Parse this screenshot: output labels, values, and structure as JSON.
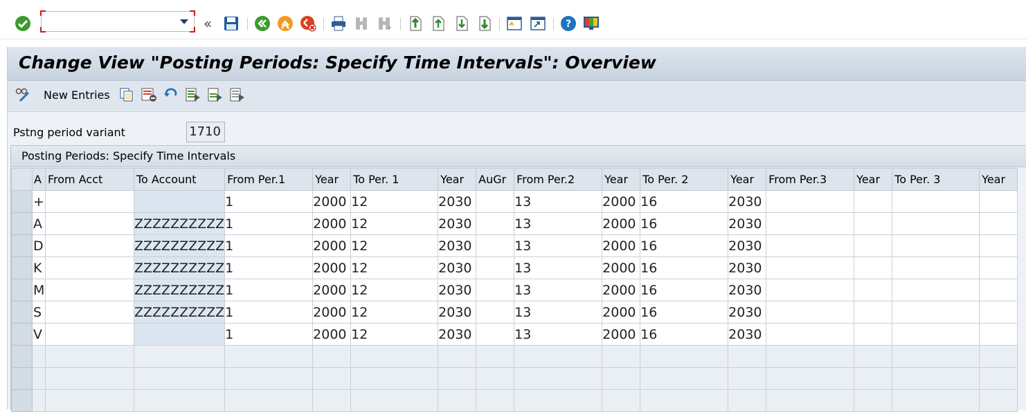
{
  "system_toolbar": {
    "command_field": {
      "value": "",
      "placeholder": ""
    },
    "icons": [
      "enter-icon",
      "command-dropdown-icon",
      "collapse-icon",
      "save-icon",
      "back-icon",
      "exit-icon",
      "cancel-icon",
      "print-icon",
      "find-icon",
      "find-next-icon",
      "first-page-icon",
      "previous-page-icon",
      "next-page-icon",
      "last-page-icon",
      "create-session-icon",
      "shortcut-icon",
      "help-icon",
      "customize-layout-icon"
    ]
  },
  "title": "Change View \"Posting Periods: Specify Time Intervals\": Overview",
  "app_toolbar": {
    "new_entries": "New Entries",
    "icons": [
      "display-change-icon",
      "copy-as-icon",
      "delete-icon",
      "undo-change-icon",
      "select-all-icon",
      "select-block-icon",
      "deselect-all-icon"
    ]
  },
  "header_field": {
    "label": "Pstng period variant",
    "value": "1710"
  },
  "table": {
    "title": "Posting Periods: Specify Time Intervals",
    "columns": [
      "A",
      "From Acct",
      "To Account",
      "From Per.1",
      "Year",
      "To Per. 1",
      "Year",
      "AuGr",
      "From Per.2",
      "Year",
      "To Per. 2",
      "Year",
      "From Per.3",
      "Year",
      "To Per. 3",
      "Year"
    ],
    "rows": [
      [
        "+",
        "",
        "",
        "1",
        "2000",
        "12",
        "2030",
        "",
        "13",
        "2000",
        "16",
        "2030",
        "",
        "",
        "",
        ""
      ],
      [
        "A",
        "",
        "ZZZZZZZZZZ",
        "1",
        "2000",
        "12",
        "2030",
        "",
        "13",
        "2000",
        "16",
        "2030",
        "",
        "",
        "",
        ""
      ],
      [
        "D",
        "",
        "ZZZZZZZZZZ",
        "1",
        "2000",
        "12",
        "2030",
        "",
        "13",
        "2000",
        "16",
        "2030",
        "",
        "",
        "",
        ""
      ],
      [
        "K",
        "",
        "ZZZZZZZZZZ",
        "1",
        "2000",
        "12",
        "2030",
        "",
        "13",
        "2000",
        "16",
        "2030",
        "",
        "",
        "",
        ""
      ],
      [
        "M",
        "",
        "ZZZZZZZZZZ",
        "1",
        "2000",
        "12",
        "2030",
        "",
        "13",
        "2000",
        "16",
        "2030",
        "",
        "",
        "",
        ""
      ],
      [
        "S",
        "",
        "ZZZZZZZZZZ",
        "1",
        "2000",
        "12",
        "2030",
        "",
        "13",
        "2000",
        "16",
        "2030",
        "",
        "",
        "",
        ""
      ],
      [
        "V",
        "",
        "",
        "1",
        "2000",
        "12",
        "2030",
        "",
        "13",
        "2000",
        "16",
        "2030",
        "",
        "",
        "",
        ""
      ]
    ],
    "empty_rows": 3
  },
  "colors": {
    "accent_green": "#3c9a2c",
    "accent_orange": "#f29a1d",
    "accent_red": "#d9421e",
    "brand_blue": "#1e5b9c"
  }
}
